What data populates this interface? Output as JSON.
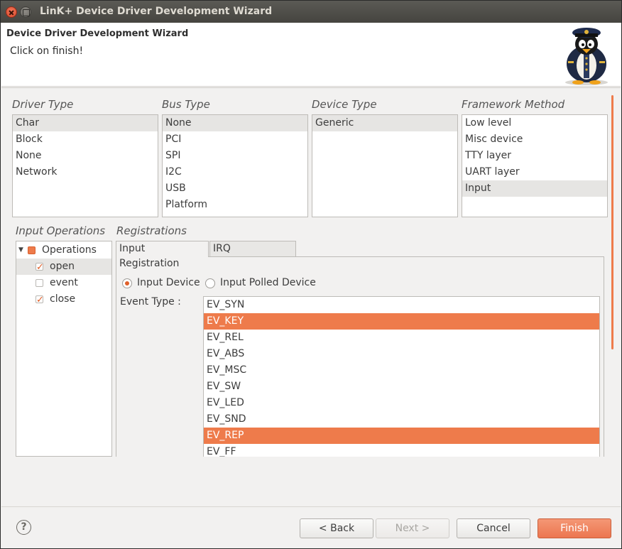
{
  "window": {
    "title": "LinK+ Device Driver Development Wizard"
  },
  "header": {
    "title": "Device Driver Development Wizard",
    "message": "Click on finish!"
  },
  "driver_type": {
    "label": "Driver Type",
    "items": [
      "Char",
      "Block",
      "None",
      "Network"
    ],
    "selected": "Char"
  },
  "bus_type": {
    "label": "Bus Type",
    "items": [
      "None",
      "PCI",
      "SPI",
      "I2C",
      "USB",
      "Platform"
    ],
    "selected": "None"
  },
  "device_type": {
    "label": "Device Type",
    "items": [
      "Generic"
    ],
    "selected": "Generic"
  },
  "framework_method": {
    "label": "Framework Method",
    "items": [
      "Low level",
      "Misc device",
      "TTY layer",
      "UART layer",
      "Input"
    ],
    "selected": "Input"
  },
  "input_operations": {
    "label": "Input Operations",
    "root": "Operations",
    "children": [
      {
        "label": "open",
        "checked": true
      },
      {
        "label": "event",
        "checked": false
      },
      {
        "label": "close",
        "checked": true
      }
    ]
  },
  "registrations": {
    "label": "Registrations",
    "tabs": [
      "Input Registration",
      "IRQ Registration"
    ],
    "active_tab": "Input Registration",
    "radio": {
      "input_device": "Input Device",
      "input_polled_device": "Input Polled Device",
      "selected": "Input Device"
    },
    "event_type_label": "Event Type :",
    "event_types": [
      "EV_SYN",
      "EV_KEY",
      "EV_REL",
      "EV_ABS",
      "EV_MSC",
      "EV_SW",
      "EV_LED",
      "EV_SND",
      "EV_REP",
      "EV_FF"
    ],
    "selected_events": [
      "EV_KEY",
      "EV_REP"
    ]
  },
  "buttons": {
    "help": "?",
    "back": "< Back",
    "next": "Next >",
    "cancel": "Cancel",
    "finish": "Finish"
  },
  "colors": {
    "accent": "#ee7b4b",
    "titlebar": "#45443f"
  }
}
